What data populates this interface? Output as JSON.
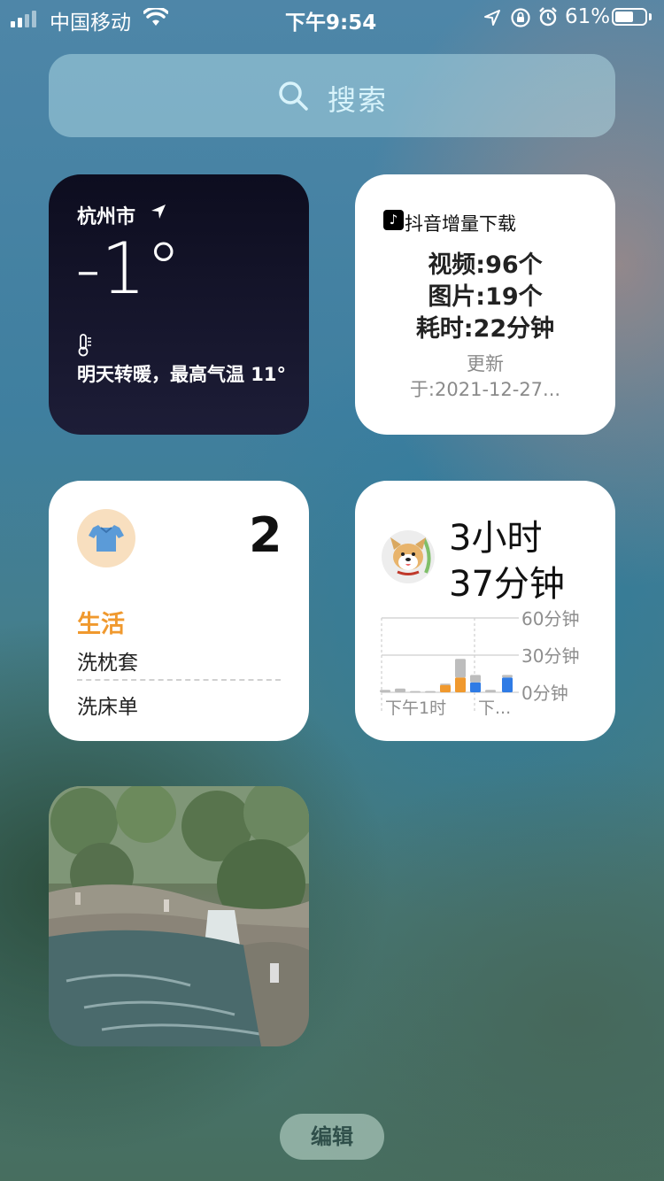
{
  "status_bar": {
    "carrier": "中国移动",
    "time": "下午9:54",
    "battery_percent": "61%",
    "battery_level": 0.61,
    "icons": [
      "signal-icon",
      "wifi-icon",
      "location-icon",
      "orientation-lock-icon",
      "alarm-icon",
      "battery-icon"
    ]
  },
  "search": {
    "label": "搜索",
    "icon": "search-icon"
  },
  "weather": {
    "city": "杭州市",
    "temperature": "-1°",
    "forecast": "明天转暖，最高气温 11°",
    "icons": [
      "location-arrow-icon",
      "thermometer-icon"
    ],
    "background": "#12122a"
  },
  "douyin": {
    "title": "抖音增量下载",
    "logo": "♪",
    "videos": "视频:96个",
    "images": "图片:19个",
    "duration": "耗时:22分钟",
    "update_line1": "更新",
    "update_line2": "于:2021-12-27..."
  },
  "reminders": {
    "count": "2",
    "list_name": "生活",
    "items": [
      "洗枕套",
      "洗床单"
    ],
    "accent": "#f0992e",
    "icon": "shirt-icon"
  },
  "screen_time": {
    "line1": "3小时",
    "line2": "37分钟",
    "icon": "dog-avatar-icon",
    "chart_data": {
      "type": "bar",
      "y_tick_labels": [
        "60分钟",
        "30分钟",
        "0分钟"
      ],
      "ylim": [
        0,
        60
      ],
      "x_tick_labels": [
        "下午1时",
        "下..."
      ],
      "series": [
        {
          "values": [
            0,
            0,
            0,
            0,
            0,
            0,
            8,
            0,
            12
          ]
        },
        {
          "values": [
            0,
            0,
            0,
            0,
            6,
            12,
            0,
            0,
            0
          ]
        },
        {
          "values": [
            2,
            3,
            1,
            1,
            1,
            15,
            6,
            2,
            2
          ]
        }
      ],
      "colors": [
        "#2f7be5",
        "#f0992e",
        "#bdbdbd"
      ]
    }
  },
  "photo": {
    "description_icon": "photo-icon"
  },
  "edit_button": {
    "label": "编辑"
  }
}
